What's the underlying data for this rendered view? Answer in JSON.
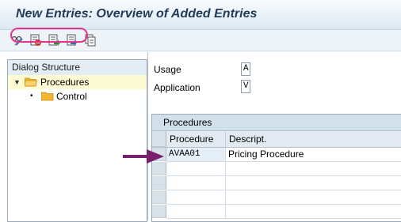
{
  "title": "New Entries: Overview of Added Entries",
  "toolbar": {
    "icons": [
      "glasses-edit-icon",
      "delete-row-icon",
      "export-icon",
      "import-icon",
      "copy-icon"
    ]
  },
  "dialog_structure": {
    "header": "Dialog Structure",
    "items": [
      {
        "label": "Procedures",
        "level": 0,
        "expanded": true,
        "selected": true
      },
      {
        "label": "Control",
        "level": 1,
        "highlighted": true
      }
    ]
  },
  "fields": [
    {
      "label": "Usage",
      "value": "A"
    },
    {
      "label": "Application",
      "value": "V"
    }
  ],
  "table": {
    "title": "Procedures",
    "columns": [
      "Procedure",
      "Descript."
    ],
    "rows": [
      {
        "procedure": "AVAA01",
        "description": "Pricing Procedure"
      }
    ]
  },
  "colors": {
    "annotation_arrow": "#7a1f6e",
    "annotation_ring": "#e6338a",
    "title_text": "#1f3b57"
  }
}
